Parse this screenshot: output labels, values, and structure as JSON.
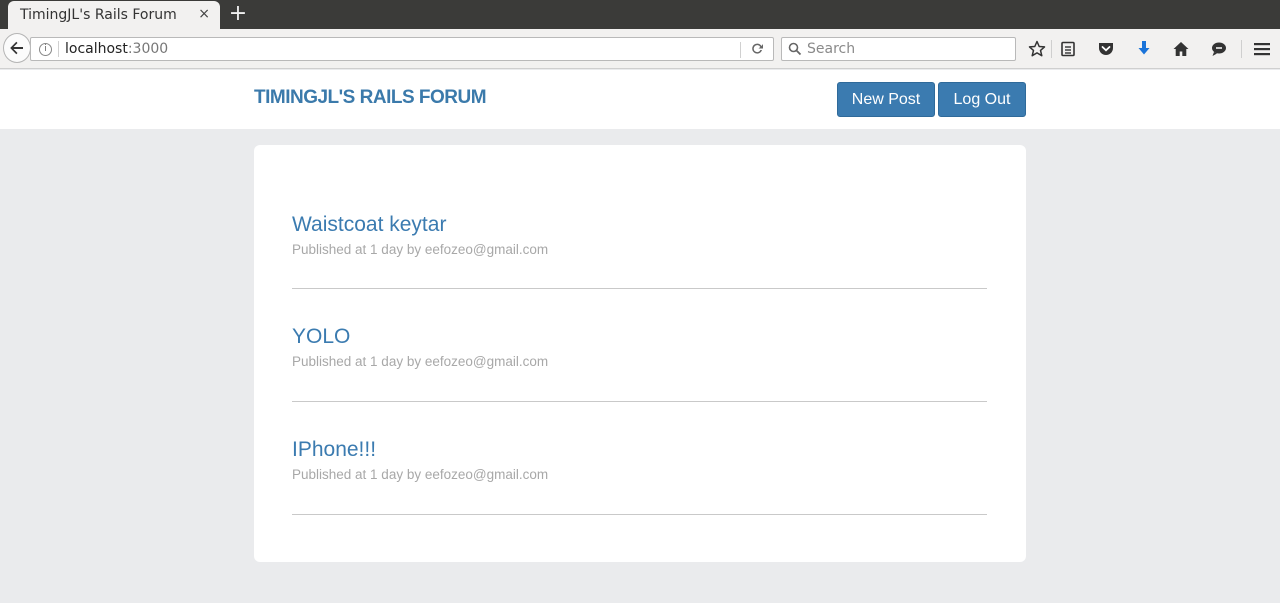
{
  "browser": {
    "tab_title": "TimingJL's Rails Forum",
    "tab_close": "×",
    "new_tab": "+",
    "url_host": "localhost",
    "url_port": ":3000",
    "search_placeholder": "Search",
    "info_icon": "i"
  },
  "header": {
    "brand": "TIMINGJL'S RAILS FORUM",
    "new_post_label": "New Post",
    "logout_label": "Log Out"
  },
  "posts": [
    {
      "title": "Waistcoat keytar",
      "meta": "Published at 1 day by eefozeo@gmail.com"
    },
    {
      "title": "YOLO",
      "meta": "Published at 1 day by eefozeo@gmail.com"
    },
    {
      "title": "IPhone!!!",
      "meta": "Published at 1 day by eefozeo@gmail.com"
    }
  ],
  "colors": {
    "accent": "#3b7bb0",
    "page_bg": "#eaebed",
    "download_arrow": "#1a73d9"
  },
  "icons": [
    "back-arrow-icon",
    "info-icon",
    "reload-icon",
    "search-icon",
    "bookmark-star-icon",
    "reading-list-icon",
    "pocket-icon",
    "download-icon",
    "home-icon",
    "chat-icon",
    "menu-icon"
  ]
}
